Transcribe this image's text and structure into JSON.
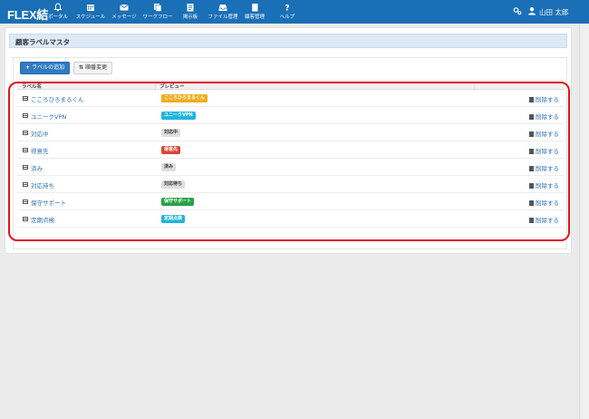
{
  "app": {
    "brand": "FLEX結"
  },
  "nav": {
    "items": [
      {
        "label": "ポータル",
        "icon": "bell-icon"
      },
      {
        "label": "スケジュール",
        "icon": "calendar-icon"
      },
      {
        "label": "メッセージ",
        "icon": "envelope-icon"
      },
      {
        "label": "ワークフロー",
        "icon": "workflow-icon"
      },
      {
        "label": "掲示板",
        "icon": "bulletin-icon"
      },
      {
        "label": "ファイル管理",
        "icon": "inbox-icon"
      },
      {
        "label": "顧客管理",
        "icon": "book-icon"
      },
      {
        "label": "ヘルプ",
        "icon": "question-icon"
      }
    ],
    "user_name": "山田 太郎"
  },
  "page": {
    "title": "顧客ラベルマスタ"
  },
  "toolbar": {
    "add_label": "ラベルの追加",
    "reorder_label": "順番変更"
  },
  "table": {
    "headers": {
      "name": "ラベル名",
      "preview": "プレビュー"
    },
    "delete_label": "削除する",
    "rows": [
      {
        "name": "こころひろまるくん",
        "preview": "こころひろまるくん",
        "color": "#f0ad1c",
        "text_color": "#ffffff"
      },
      {
        "name": "ユニークVPN",
        "preview": "ユニークVPN",
        "color": "#22b4dc",
        "text_color": "#ffffff"
      },
      {
        "name": "対応中",
        "preview": "対応中",
        "color": "#dedede",
        "text_color": "#333333"
      },
      {
        "name": "得意先",
        "preview": "得意先",
        "color": "#d9443a",
        "text_color": "#ffffff"
      },
      {
        "name": "済み",
        "preview": "済み",
        "color": "#dedede",
        "text_color": "#333333"
      },
      {
        "name": "対応待ち",
        "preview": "対応待ち",
        "color": "#dedede",
        "text_color": "#333333"
      },
      {
        "name": "保守サポート",
        "preview": "保守サポート",
        "color": "#2aa04a",
        "text_color": "#ffffff"
      },
      {
        "name": "定期点検",
        "preview": "定期点検",
        "color": "#22b4dc",
        "text_color": "#ffffff"
      }
    ]
  },
  "colors": {
    "navbar": "#1a6fb6",
    "highlight": "#e0141e",
    "link": "#2a6fb6"
  }
}
